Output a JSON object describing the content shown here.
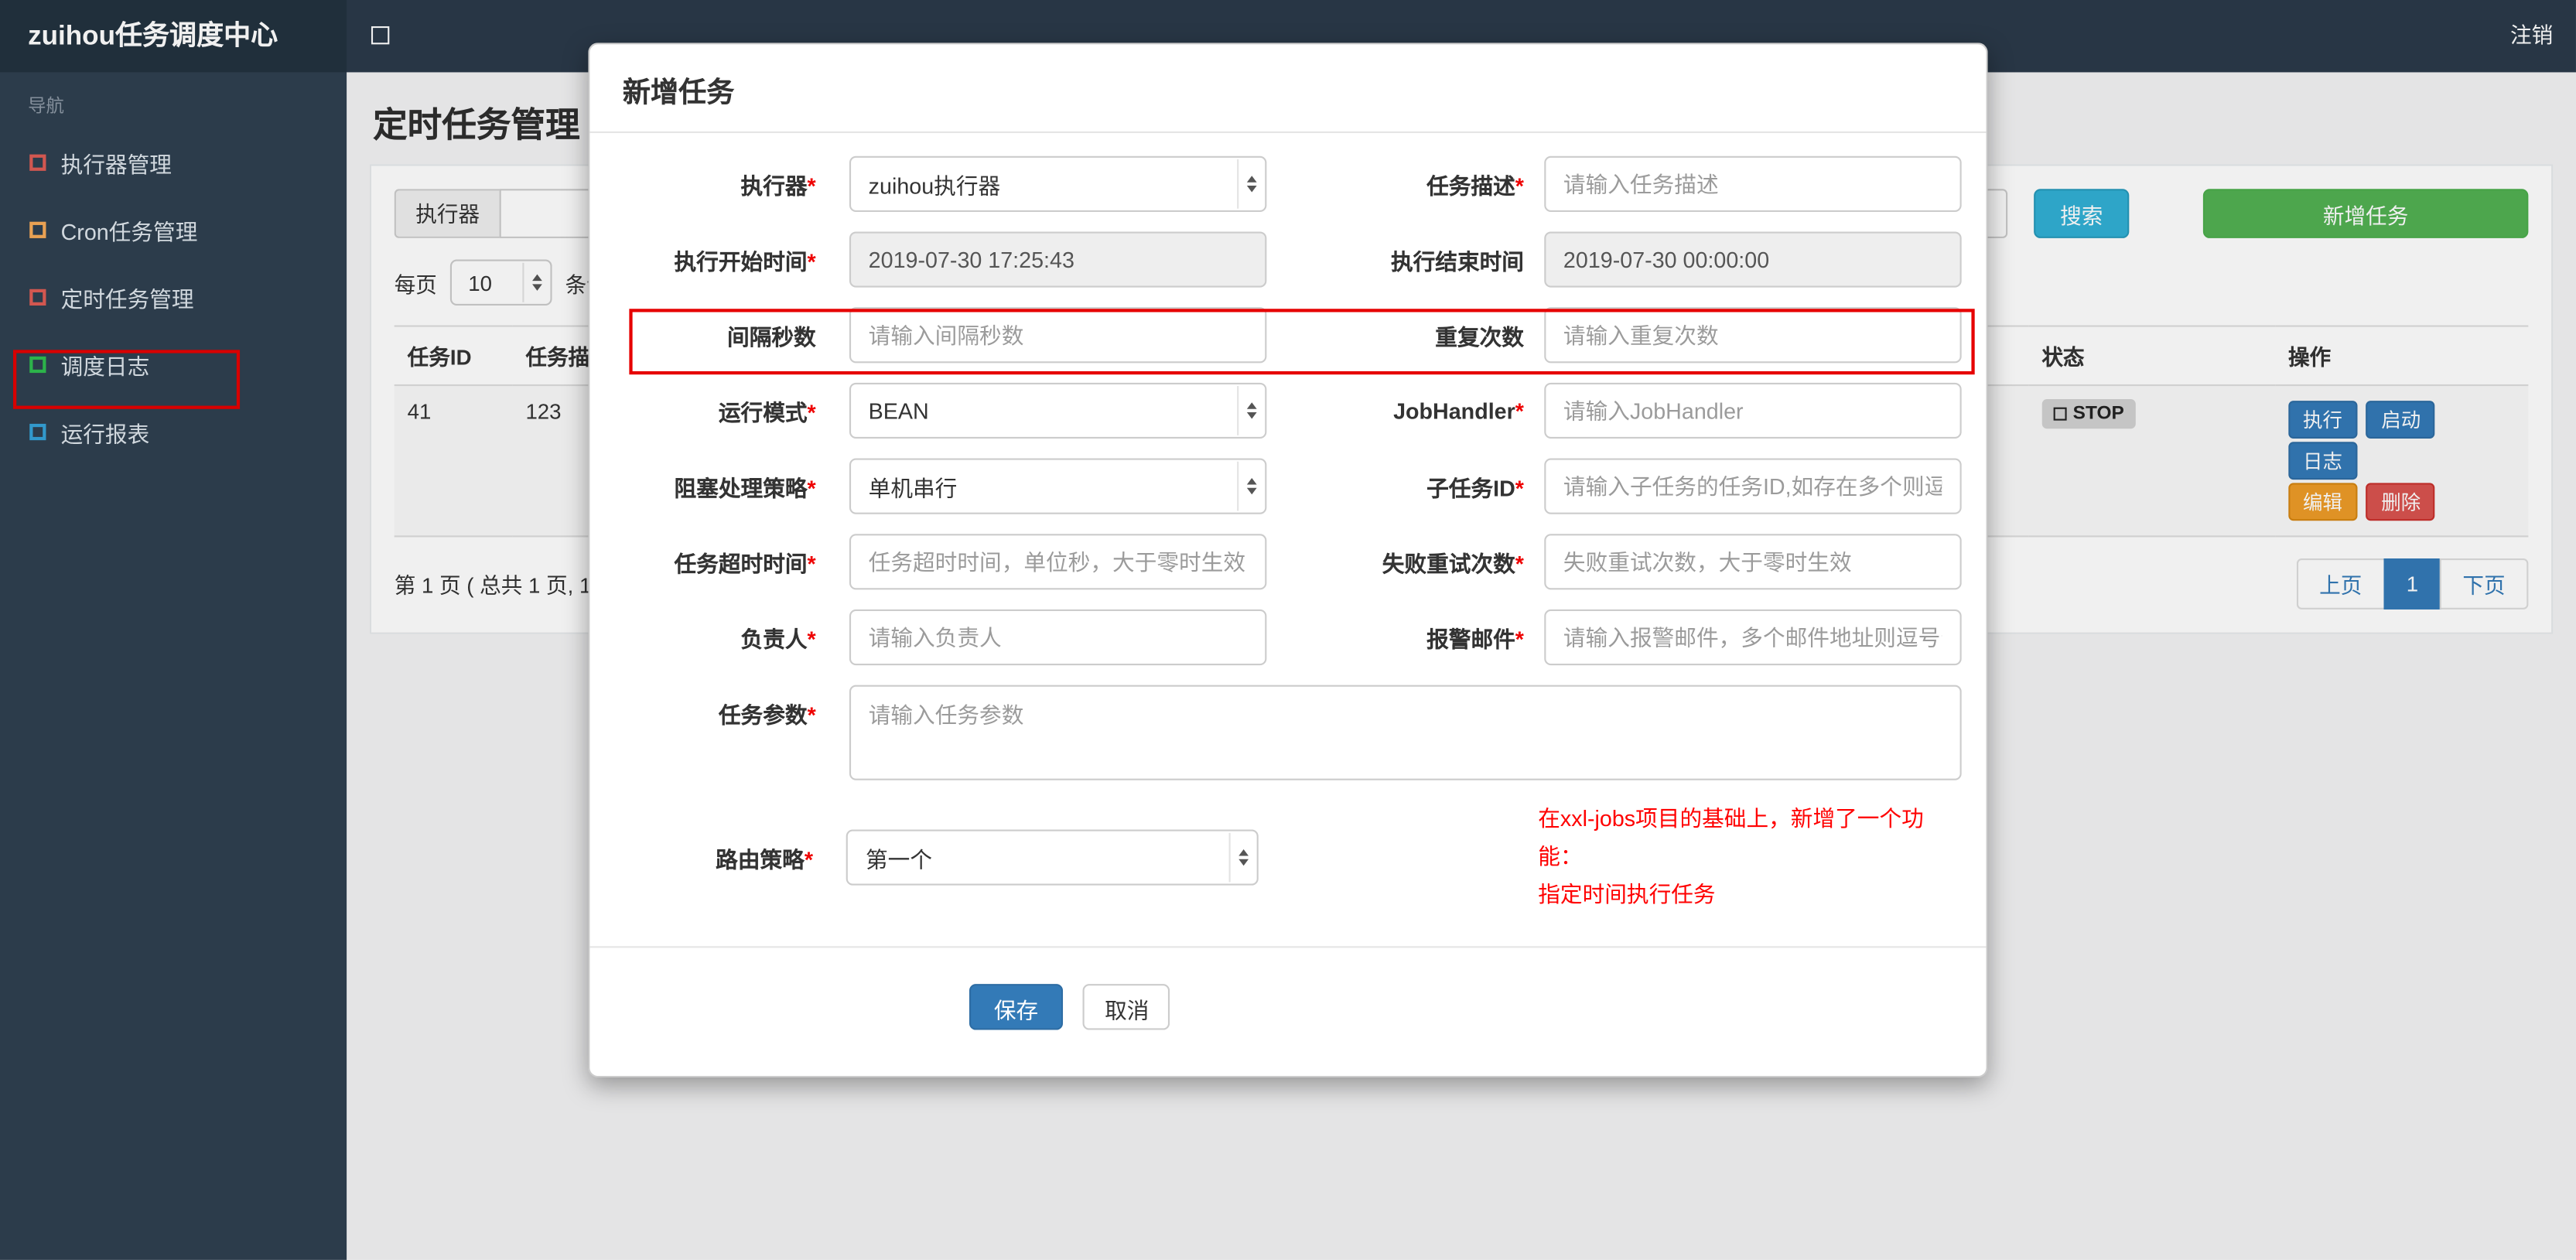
{
  "colors": {
    "primary": "#337ab7",
    "success": "#52b152",
    "info": "#31b0d5",
    "warning": "#ed9c28",
    "danger": "#d9534f",
    "annotation": "#e60000",
    "navbar": "#2b3a4a",
    "sidebar": "#2f4050"
  },
  "navbar": {
    "brand": "zuihou任务调度中心",
    "logout": "注销"
  },
  "sidebar": {
    "section": "导航",
    "items": [
      {
        "label": "执行器管理",
        "icon_color": "#e05d55"
      },
      {
        "label": "Cron任务管理",
        "icon_color": "#f8ac59"
      },
      {
        "label": "定时任务管理",
        "icon_color": "#e05d55"
      },
      {
        "label": "调度日志",
        "icon_color": "#2fbf4f"
      },
      {
        "label": "运行报表",
        "icon_color": "#36a3d9"
      }
    ]
  },
  "page": {
    "title": "定时任务管理",
    "filter": {
      "executor_addon": "执行器",
      "search": "搜索",
      "add_task": "新增任务"
    },
    "list_toolbar": {
      "per_page_prefix": "每页",
      "per_page_value": "10",
      "per_page_suffix": "条记"
    },
    "table": {
      "col_task_id": "任务ID",
      "col_task_desc": "任务描述",
      "col_status": "状态",
      "col_actions": "操作",
      "row": {
        "task_id": "41",
        "task_desc": "123",
        "status": "STOP",
        "btn_execute": "执行",
        "btn_start": "启动",
        "btn_log": "日志",
        "btn_edit": "编辑",
        "btn_delete": "删除"
      }
    },
    "pagination": {
      "summary": "第 1 页 ( 总共 1 页, 1",
      "prev": "上页",
      "page": "1",
      "next": "下页"
    }
  },
  "modal": {
    "title": "新增任务",
    "fields": {
      "executor": {
        "label": "执行器",
        "required": "*",
        "value": "zuihou执行器"
      },
      "desc": {
        "label": "任务描述",
        "required": "*",
        "placeholder": "请输入任务描述"
      },
      "start_time": {
        "label": "执行开始时间",
        "required": "*",
        "value": "2019-07-30 17:25:43"
      },
      "end_time": {
        "label": "执行结束时间",
        "value": "2019-07-30 00:00:00"
      },
      "interval": {
        "label": "间隔秒数",
        "placeholder": "请输入间隔秒数"
      },
      "repeat": {
        "label": "重复次数",
        "placeholder": "请输入重复次数"
      },
      "mode": {
        "label": "运行模式",
        "required": "*",
        "value": "BEAN"
      },
      "jobhandler": {
        "label": "JobHandler",
        "required": "*",
        "placeholder": "请输入JobHandler"
      },
      "block": {
        "label": "阻塞处理策略",
        "required": "*",
        "value": "单机串行"
      },
      "child": {
        "label": "子任务ID",
        "required": "*",
        "placeholder": "请输入子任务的任务ID,如存在多个则逗"
      },
      "timeout": {
        "label": "任务超时时间",
        "required": "*",
        "placeholder": "任务超时时间，单位秒，大于零时生效"
      },
      "retry": {
        "label": "失败重试次数",
        "required": "*",
        "placeholder": "失败重试次数，大于零时生效"
      },
      "owner": {
        "label": "负责人",
        "required": "*",
        "placeholder": "请输入负责人"
      },
      "email": {
        "label": "报警邮件",
        "required": "*",
        "placeholder": "请输入报警邮件，多个邮件地址则逗号分"
      },
      "params": {
        "label": "任务参数",
        "required": "*",
        "placeholder": "请输入任务参数"
      },
      "route": {
        "label": "路由策略",
        "required": "*",
        "value": "第一个"
      }
    },
    "note1": "在xxl-jobs项目的基础上，新增了一个功能：",
    "note2": "指定时间执行任务",
    "save": "保存",
    "cancel": "取消"
  }
}
